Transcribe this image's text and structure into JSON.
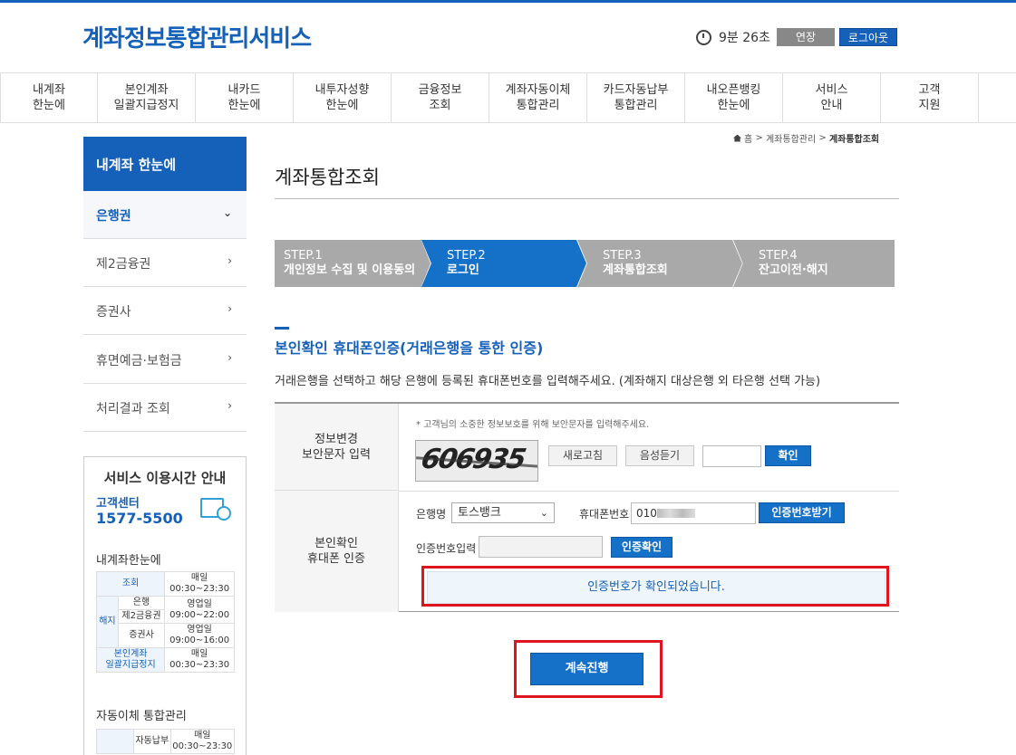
{
  "header": {
    "logo": "계좌정보통합관리서비스",
    "timer": "9분 26초",
    "extend_label": "연장",
    "logout_label": "로그아웃"
  },
  "gnb": [
    {
      "line1": "내계좌",
      "line2": "한눈에"
    },
    {
      "line1": "본인계좌",
      "line2": "일괄지급정지"
    },
    {
      "line1": "내카드",
      "line2": "한눈에"
    },
    {
      "line1": "내투자성향",
      "line2": "한눈에"
    },
    {
      "line1": "금융정보",
      "line2": "조회"
    },
    {
      "line1": "계좌자동이체",
      "line2": "통합관리"
    },
    {
      "line1": "카드자동납부",
      "line2": "통합관리"
    },
    {
      "line1": "내오픈뱅킹",
      "line2": "한눈에"
    },
    {
      "line1": "서비스",
      "line2": "안내"
    },
    {
      "line1": "고객",
      "line2": "지원"
    }
  ],
  "sidebar": {
    "title": "내계좌 한눈에",
    "items": [
      "은행권",
      "제2금융권",
      "증권사",
      "휴면예금·보험금",
      "처리결과 조회"
    ]
  },
  "service_info": {
    "title": "서비스 이용시간 안내",
    "cc_label": "고객센터",
    "cc_number": "1577-5500",
    "section1": "내계좌한눈에",
    "t_query": "조회",
    "t_daily": "매일",
    "t_time1": "00:30~23:30",
    "t_cancel": "해지",
    "t_bank": "은행",
    "t_bizday": "영업일",
    "t_time2": "09:00~22:00",
    "t_second": "제2금융권",
    "t_sec": "증권사",
    "t_time3": "09:00~16:00",
    "t_stop1": "본인계좌",
    "t_stop2": "일괄지급정지",
    "t_time4": "00:30~23:30",
    "section2": "자동이체 통합관리",
    "t_autopay": "자동납부",
    "t_time5": "00:30~23:30"
  },
  "breadcrumb": {
    "home": "홈",
    "sep": ">",
    "mid": "계좌통합관리",
    "current": "계좌통합조회"
  },
  "page": {
    "title": "계좌통합조회"
  },
  "steps": [
    {
      "num": "STEP.1",
      "label": "개인정보 수집 및 이용동의"
    },
    {
      "num": "STEP.2",
      "label": "로그인"
    },
    {
      "num": "STEP.3",
      "label": "계좌통합조회"
    },
    {
      "num": "STEP.4",
      "label": "잔고이전·해지"
    }
  ],
  "section": {
    "title": "본인확인 휴대폰인증(거래은행을 통한 인증)",
    "desc": "거래은행을 선택하고 해당 은행에 등록된 휴대폰번호를 입력해주세요. (계좌해지 대상은행 외 타은행 선택 가능)"
  },
  "form": {
    "row1_line1": "정보변경",
    "row1_line2": "보안문자 입력",
    "note": "* 고객님의 소중한 정보보호를 위해 보안문자를 입력해주세요.",
    "captcha": "606935",
    "refresh_label": "새로고침",
    "audio_label": "음성듣기",
    "confirm_label": "확인",
    "row2_line1": "본인확인",
    "row2_line2": "휴대폰 인증",
    "bank_label": "은행명",
    "bank_value": "토스뱅크",
    "phone_label": "휴대폰번호",
    "phone_value": "010",
    "request_code_label": "인증번호받기",
    "code_label": "인증번호입력",
    "verify_label": "인증확인",
    "verified_message": "인증번호가 확인되었습니다."
  },
  "continue_label": "계속진행",
  "colors": {
    "primary": "#1560b8",
    "highlight": "#e0141e"
  }
}
